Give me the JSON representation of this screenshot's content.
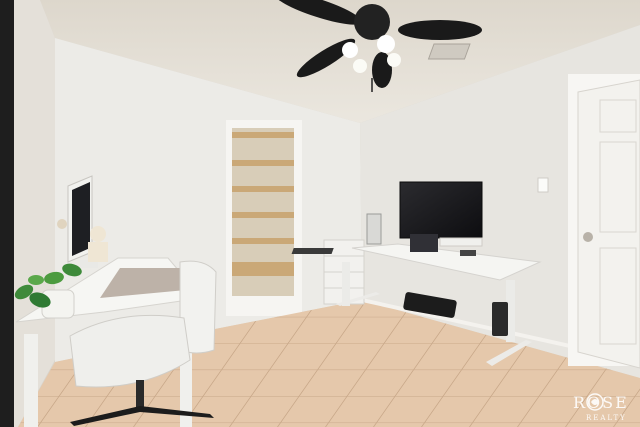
{
  "watermark": {
    "brand": "ROSE",
    "sub": "REALTY"
  },
  "colors": {
    "wall": "#ece9e3",
    "ceiling": "#e6e1d8",
    "floor_tile": "#e5c8ab",
    "floor_grout": "#c9a98a",
    "shelf_wood": "#caa877",
    "door": "#f3f2ee",
    "desk": "#f5f5f2",
    "monitor": "#151515",
    "fan": "#1a1a1a"
  }
}
